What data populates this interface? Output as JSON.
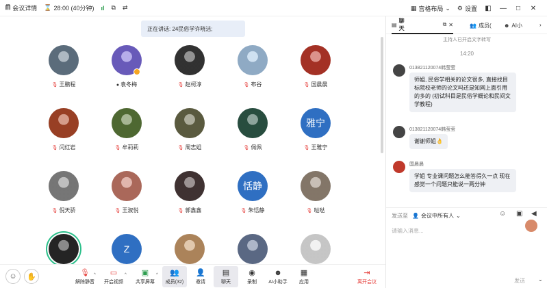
{
  "topbar": {
    "meeting_details": "会议详情",
    "duration": "28:00 (40分钟)",
    "layout": "宫格布局",
    "settings": "设置"
  },
  "stage": {
    "speaking": "正在讲话: 24民俗学许晓洁;",
    "participants": [
      {
        "name": "王鹏程",
        "kind": "photo",
        "color": "#6b7f90",
        "muted": true
      },
      {
        "name": "袁冬梅",
        "kind": "photo",
        "color": "#7a6ad9",
        "muted": false,
        "host": true
      },
      {
        "name": "赵柯淳",
        "kind": "photo",
        "color": "#3a3a3a",
        "muted": true
      },
      {
        "name": "布谷",
        "kind": "photo",
        "color": "#a8c8e6",
        "muted": true
      },
      {
        "name": "国晨晨",
        "kind": "photo",
        "color": "#c0392b",
        "muted": true
      },
      {
        "name": "闫红岩",
        "kind": "photo",
        "color": "#b34a2a",
        "muted": true
      },
      {
        "name": "牟莉莉",
        "kind": "photo",
        "color": "#5c7a3a",
        "muted": true
      },
      {
        "name": "周志姐",
        "kind": "photo",
        "color": "#6a6a4a",
        "muted": true
      },
      {
        "name": "佩佩",
        "kind": "photo",
        "color": "#2f5a4a",
        "muted": true
      },
      {
        "name": "王雅宁",
        "kind": "text",
        "initial": "雅宁",
        "color": "#2f6fc2",
        "muted": true
      },
      {
        "name": "倪天骄",
        "kind": "photo",
        "color": "#8a8a8a",
        "muted": true
      },
      {
        "name": "王淑悦",
        "kind": "photo",
        "color": "#c87a6a",
        "muted": true
      },
      {
        "name": "郭鑫鑫",
        "kind": "photo",
        "color": "#4a3a3a",
        "muted": true
      },
      {
        "name": "朱恬静",
        "kind": "text",
        "initial": "恬静",
        "color": "#2f6fc2",
        "muted": true
      },
      {
        "name": "哒哒",
        "kind": "photo",
        "color": "#9a8a7a",
        "muted": true
      },
      {
        "name": "",
        "kind": "photo",
        "color": "#2a2a2a",
        "muted": false,
        "ring": true
      },
      {
        "name": "",
        "kind": "text",
        "initial": "Z",
        "color": "#2f6fc2",
        "muted": false
      },
      {
        "name": "",
        "kind": "photo",
        "color": "#c99a6a",
        "muted": false
      },
      {
        "name": "",
        "kind": "photo",
        "color": "#6a7a9a",
        "muted": false
      },
      {
        "name": "",
        "kind": "photo",
        "color": "#e8e8e8",
        "muted": false
      }
    ]
  },
  "toolbar": {
    "unmute": "解除静音",
    "start_video": "开启视频",
    "share_screen": "共享屏幕",
    "members": "成员(32)",
    "invite": "邀请",
    "chat": "聊天",
    "record": "录制",
    "ai_assistant": "AI小助手",
    "apps": "应用",
    "leave": "离开会议"
  },
  "panel": {
    "tab_chat": "聊天",
    "tab_members": "成员(",
    "tab_ai": "AI小",
    "notice": "主持人已开启文字转写",
    "time": "14:20",
    "messages": [
      {
        "sender": "013821120074韩莹莹",
        "text": "师姐, 民俗学相关的论文很多, 直接找目标院校老师的论文吗还是知网上面引用的多的 (初试科目是民俗学概论和民间文学教程)",
        "color": "#444"
      },
      {
        "sender": "013821120074韩莹莹",
        "text": "谢谢师姐👌",
        "color": "#444"
      },
      {
        "sender": "国晨晨",
        "text": "学姐 专业课问题怎么能答得久一点 现在感觉一个问题只能说一两分钟",
        "color": "#c0392b"
      }
    ],
    "send_to_label": "发送至",
    "send_to_value": "会议中所有人",
    "input_placeholder": "请输入消息...",
    "send_button": "发送"
  },
  "colors": {
    "accent": "#2f6fc2",
    "danger": "#e53935",
    "bubble": "#eef0f4"
  }
}
